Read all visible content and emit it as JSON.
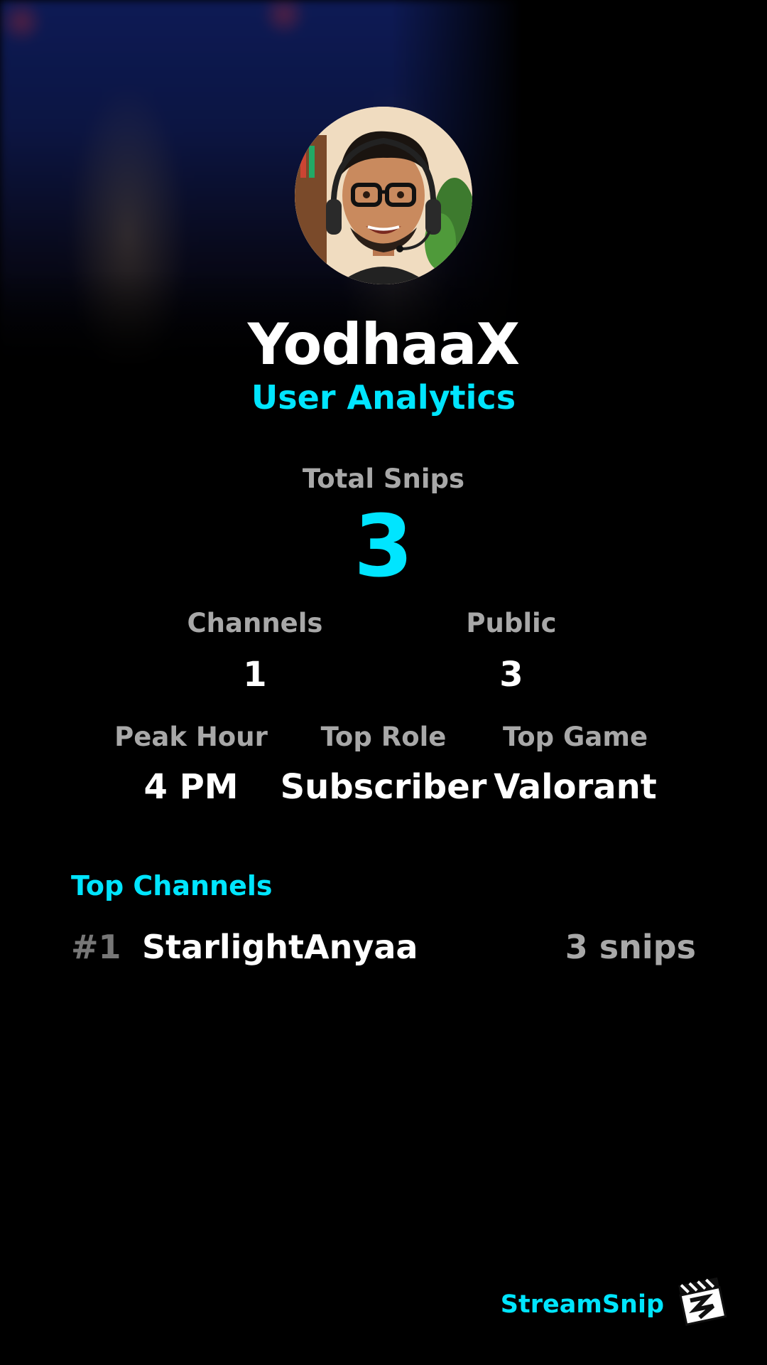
{
  "profile": {
    "username": "YodhaaX",
    "subtitle": "User Analytics"
  },
  "totals": {
    "label": "Total Snips",
    "value": "3"
  },
  "stats_row1": [
    {
      "label": "Channels",
      "value": "1"
    },
    {
      "label": "Public",
      "value": "3"
    }
  ],
  "stats_row2": [
    {
      "label": "Peak Hour",
      "value": "4 PM"
    },
    {
      "label": "Top Role",
      "value": "Subscriber"
    },
    {
      "label": "Top Game",
      "value": "Valorant"
    }
  ],
  "top_channels": {
    "title": "Top Channels",
    "items": [
      {
        "rank": "#1",
        "name": "StarlightAnyaa",
        "count": "3 snips"
      }
    ]
  },
  "footer": {
    "brand": "StreamSnip",
    "logo_icon": "clapperboard-icon"
  },
  "colors": {
    "accent": "#00e5ff",
    "muted": "#a8a8a8",
    "background": "#000000"
  }
}
